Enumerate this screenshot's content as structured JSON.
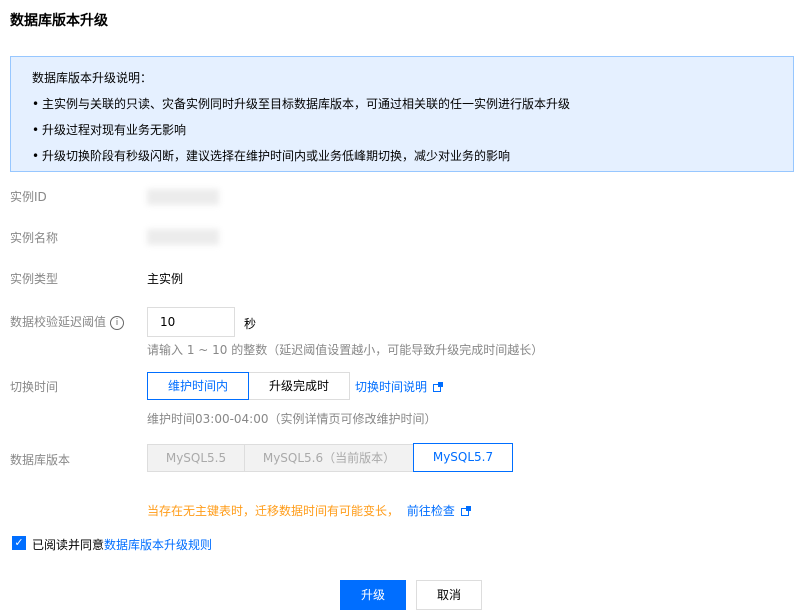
{
  "title": "数据库版本升级",
  "notice": {
    "heading": "数据库版本升级说明：",
    "items": [
      "主实例与关联的只读、灾备实例同时升级至目标数据库版本，可通过相关联的任一实例进行版本升级",
      "升级过程对现有业务无影响",
      "升级切换阶段有秒级闪断，建议选择在维护时间内或业务低峰期切换，减少对业务的影响"
    ]
  },
  "fields": {
    "instance_id_label": "实例ID",
    "instance_name_label": "实例名称",
    "instance_type_label": "实例类型",
    "instance_type_value": "主实例",
    "delay_label": "数据校验延迟阈值",
    "delay_value": "10",
    "delay_unit": "秒",
    "delay_hint": "请输入 1 ~ 10 的整数（延迟阈值设置越小，可能导致升级完成时间越长）",
    "switch_label": "切换时间",
    "switch_options": [
      "维护时间内",
      "升级完成时"
    ],
    "switch_link": "切换时间说明",
    "switch_hint": "维护时间03:00-04:00（实例详情页可修改维护时间）",
    "version_label": "数据库版本",
    "version_options": [
      "MySQL5.5",
      "MySQL5.6（当前版本）",
      "MySQL5.7"
    ]
  },
  "warning": {
    "text": "当存在无主键表时，迁移数据时间有可能变长，",
    "link": "前往检查"
  },
  "agreement": {
    "text": "已阅读并同意",
    "link": "数据库版本升级规则"
  },
  "buttons": {
    "confirm": "升级",
    "cancel": "取消"
  },
  "colors": {
    "accent": "#006eff",
    "warning": "#ff9c19",
    "notice_bg": "#e5f0ff"
  }
}
